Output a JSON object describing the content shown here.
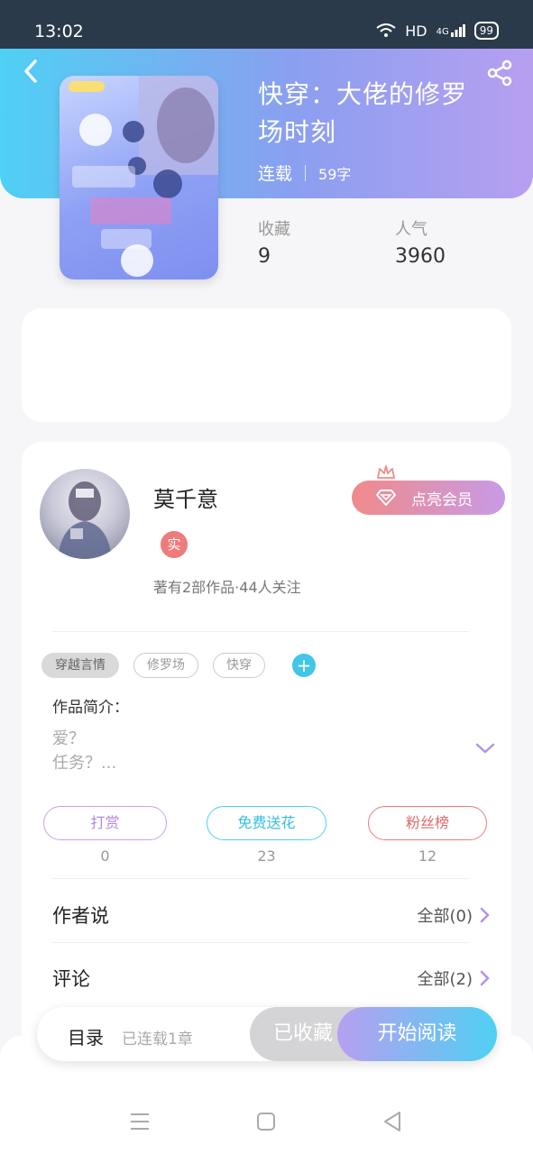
{
  "status_bar": {
    "time": "13:02",
    "network": "HD",
    "signal": "4G",
    "battery": "99"
  },
  "book": {
    "title": "快穿：大佬的修罗场时刻",
    "status": "连载",
    "words": "59字"
  },
  "stats": [
    {
      "label": "收藏",
      "value": "9"
    },
    {
      "label": "人气",
      "value": "3960"
    }
  ],
  "author": {
    "name": "莫千意",
    "badge": "实",
    "summary": "著有2部作品·44人关注",
    "vip_label": "点亮会员"
  },
  "tags": [
    "穿越言情",
    "修罗场",
    "快穿"
  ],
  "intro": {
    "label": "作品简介：",
    "text": "爱？\n任务？..."
  },
  "actions": [
    {
      "label": "打赏",
      "count": "0",
      "color": "#c7a3e8"
    },
    {
      "label": "免费送花",
      "count": "23",
      "color": "#4fd0f4"
    },
    {
      "label": "粉丝榜",
      "count": "12",
      "color": "#ef7b7b"
    }
  ],
  "rows": [
    {
      "label": "作者说",
      "right": "全部(0)"
    },
    {
      "label": "评论",
      "right": "全部(2)"
    }
  ],
  "bottom_bar": {
    "toc": "目录",
    "chapter_count": "已连载1章",
    "favorited": "已收藏",
    "read": "开始阅读"
  },
  "colors": {
    "accent_cyan": "#4fd0f4",
    "accent_purple": "#b79ff0",
    "vip_pink": "#f08a8a"
  },
  "icons": [
    "back-arrow-icon",
    "share-icon",
    "wifi-icon",
    "signal-icon",
    "battery-icon",
    "crown-icon",
    "diamond-icon",
    "plus-icon",
    "chevron-down-icon",
    "chevron-right-icon",
    "menu-icon",
    "home-icon",
    "back-icon"
  ]
}
